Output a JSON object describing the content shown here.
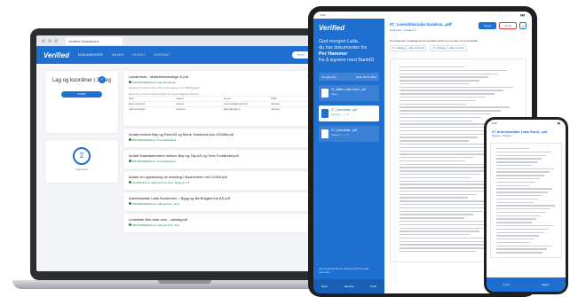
{
  "laptop": {
    "tab_title": "Verified Dashboard",
    "logo": "Verified",
    "nav": [
      "DOKUMENTER",
      "MALER",
      "KLIENT",
      "KONTAKT"
    ],
    "header_button": "NYTT",
    "hero": {
      "title": "Lag og koordiner i 3 steg",
      "button": "START"
    },
    "counter": {
      "value": "2",
      "label": "Signaturer"
    },
    "docs": [
      {
        "title": "Lønderfrukt - Mølleleiebakstegn D.pdf",
        "status": "PROSESSERES av Laila Sundersen",
        "link": "Vis tilgang"
      },
      {
        "title": "Avtale mellom Bøy og Reis AS og Morte Solstrand Ans 123456.pdf",
        "status": "PROSESSERES av Trine Bekkeland",
        "link": ""
      },
      {
        "title": "Avtale Snadrbanement mellom Bøy og Tap AS og Trine Forhåndet.pdf",
        "status": "PROSESSERES av Trine Bekkeland",
        "link": ""
      },
      {
        "title": "Avtale om oppløsning av endeling i Øyaneveien nell 12345.pdf",
        "status": "AVVENTES av Laila gammel, Dine, Bergene 2.5",
        "link": ""
      },
      {
        "title": "Arbeidsavtale Laila Sundersen – Bygg og Bø Bolgjerr.tue AS.pdf",
        "status": "PROSESSERES av Laila gammel, Dine",
        "link": ""
      },
      {
        "title": "Leasetide Bok-lede-over - varlaity.pdf",
        "status": "PROSESSERES av Laila gammel, Dine",
        "link": ""
      }
    ],
    "first_doc_meta": [
      "Opprettet 07 Februar 2021 12:00 av Per Hammer, CC: 5848 Bygglalm",
      "Møter på en omhelt av Alkos Mönttar til 3 signere følgende dokument"
    ],
    "signers": [
      [
        "Navn",
        "Signert",
        "E-post",
        "Rolle"
      ],
      [
        "Morte Solstrand",
        "Signert",
        "morte.solst@gmail.com",
        "Signerer"
      ],
      [
        "Laila Sundersen",
        "Avventer",
        "laila.s@bygg.no",
        "Signerer"
      ]
    ]
  },
  "tablet": {
    "time": "9:41",
    "logo": "Verified",
    "greeting_1": "God morgen Laila,",
    "greeting_2": "du har dokumenter fra",
    "greeting_3": "Per Hammer",
    "greeting_4": "fra å signere med BankID",
    "select_label": "Till signering",
    "select_value": "Dette 30.07.2021",
    "docs": [
      {
        "title": "01_Bilder Laila Sund...pdf",
        "sub": "Signer"
      },
      {
        "title": "07_Leiemåttal...pdf",
        "sub": "Signerer: → 1 · 5"
      },
      {
        "title": "07_Leiemåttal...pdf",
        "sub": "Signerer: → 1 · 5"
      }
    ],
    "help": "Har du spørsmål om dokumentet? Kontakt avsender",
    "bottom_nav": [
      "Hjem",
      "Signerte",
      "Profil"
    ],
    "doc_title": "07_Leiemåttal.laila.Sunders...pdf",
    "doc_sub": "Dokument · Rediger ▾",
    "sign_button": "Signer",
    "reject_button": "Avslå",
    "attach_text": "Det følgende 2 vedleggene fem til dokumentet (se om dem for du fortsetter",
    "attachments": [
      "07_Vedlegg_1_Laila_Sund.pdf",
      "07_Vedlegg_2_Laila_Sund.pdf"
    ]
  },
  "phone": {
    "time": "9:41",
    "doc_title": "07 Arbeidsavtale Laila Sund...pdf",
    "doc_sub": "Signerer · Rediger ▾",
    "bottom_nav": [
      "Avslå",
      "Signer"
    ]
  },
  "colors": {
    "brand": "#1f6fd1",
    "reject": "#dd3333",
    "success": "#1f8a4c"
  }
}
